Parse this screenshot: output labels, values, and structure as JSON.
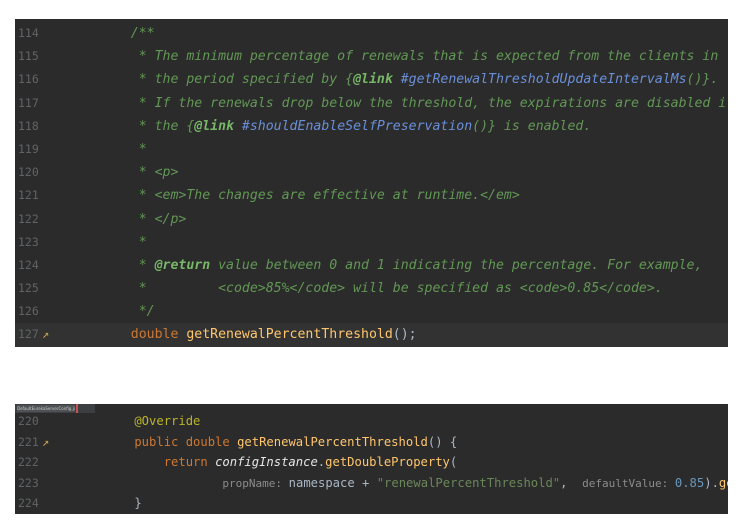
{
  "panel1": {
    "lines": [
      {
        "n": "114",
        "code": "    /**"
      },
      {
        "n": "115",
        "parts": [
          [
            "c",
            "     * The minimum percentage of renewals that is expected from the clients in"
          ]
        ]
      },
      {
        "n": "116",
        "parts": [
          [
            "c",
            "     * the period specified by {"
          ],
          [
            "ct",
            "@link"
          ],
          [
            "cl",
            " #getRenewalThresholdUpdateIntervalMs"
          ],
          [
            "c",
            "()}."
          ]
        ]
      },
      {
        "n": "117",
        "parts": [
          [
            "c",
            "     * If the renewals drop below the threshold, the expirations are disabled if"
          ]
        ]
      },
      {
        "n": "118",
        "parts": [
          [
            "c",
            "     * the {"
          ],
          [
            "ct",
            "@link"
          ],
          [
            "cl",
            " #shouldEnableSelfPreservation"
          ],
          [
            "c",
            "()} is enabled."
          ]
        ]
      },
      {
        "n": "119",
        "parts": [
          [
            "c",
            "     *"
          ]
        ]
      },
      {
        "n": "120",
        "parts": [
          [
            "c",
            "     * <p>"
          ]
        ]
      },
      {
        "n": "121",
        "parts": [
          [
            "c",
            "     * <em>The changes are effective at runtime.</em>"
          ]
        ]
      },
      {
        "n": "122",
        "parts": [
          [
            "c",
            "     * </p>"
          ]
        ]
      },
      {
        "n": "123",
        "parts": [
          [
            "c",
            "     *"
          ]
        ]
      },
      {
        "n": "124",
        "parts": [
          [
            "c",
            "     * "
          ],
          [
            "ct",
            "@return"
          ],
          [
            "c",
            " value between 0 and 1 indicating the percentage. For example,"
          ]
        ]
      },
      {
        "n": "125",
        "parts": [
          [
            "c",
            "     *         <code>85%</code> will be specified as <code>0.85</code>."
          ]
        ]
      },
      {
        "n": "126",
        "parts": [
          [
            "c",
            "     */"
          ]
        ]
      },
      {
        "n": "127",
        "icon": true,
        "current": true,
        "parts": [
          [
            "kw",
            "    double "
          ],
          [
            "fn",
            "getRenewalPercentThreshold"
          ],
          [
            "ident",
            "();"
          ]
        ]
      }
    ]
  },
  "panel2": {
    "tab_label": "DefaultEurekaServerConfig.java",
    "lines": [
      {
        "n": "220",
        "parts": [
          [
            "ann",
            "    @Override"
          ]
        ]
      },
      {
        "n": "221",
        "icon": true,
        "parts": [
          [
            "kw",
            "    public double "
          ],
          [
            "fn",
            "getRenewalPercentThreshold"
          ],
          [
            "ident",
            "() {"
          ]
        ]
      },
      {
        "n": "222",
        "parts": [
          [
            "kw",
            "        return "
          ],
          [
            "it",
            "configInstance"
          ],
          [
            "ident",
            "."
          ],
          [
            "fn",
            "getDoubleProperty"
          ],
          [
            "ident",
            "("
          ]
        ]
      },
      {
        "n": "223",
        "parts": [
          [
            "ident",
            "                "
          ],
          [
            "hint",
            "propName: "
          ],
          [
            "ident",
            "namespace + "
          ],
          [
            "str",
            "\"renewalPercentThreshold\""
          ],
          [
            "ident",
            ",  "
          ],
          [
            "hint",
            "defaultValue: "
          ],
          [
            "num",
            "0.85"
          ],
          [
            "ident",
            ")."
          ],
          [
            "fn",
            "get"
          ],
          [
            "ident",
            "();"
          ]
        ]
      },
      {
        "n": "224",
        "parts": [
          [
            "ident",
            "    }"
          ]
        ]
      }
    ]
  },
  "colors": {
    "editor_bg": "#2b2b2b",
    "comment": "#629755",
    "keyword": "#cc7832",
    "method": "#ffc66d",
    "string": "#6a8759",
    "number": "#6897bb",
    "annotation": "#bbb529"
  }
}
